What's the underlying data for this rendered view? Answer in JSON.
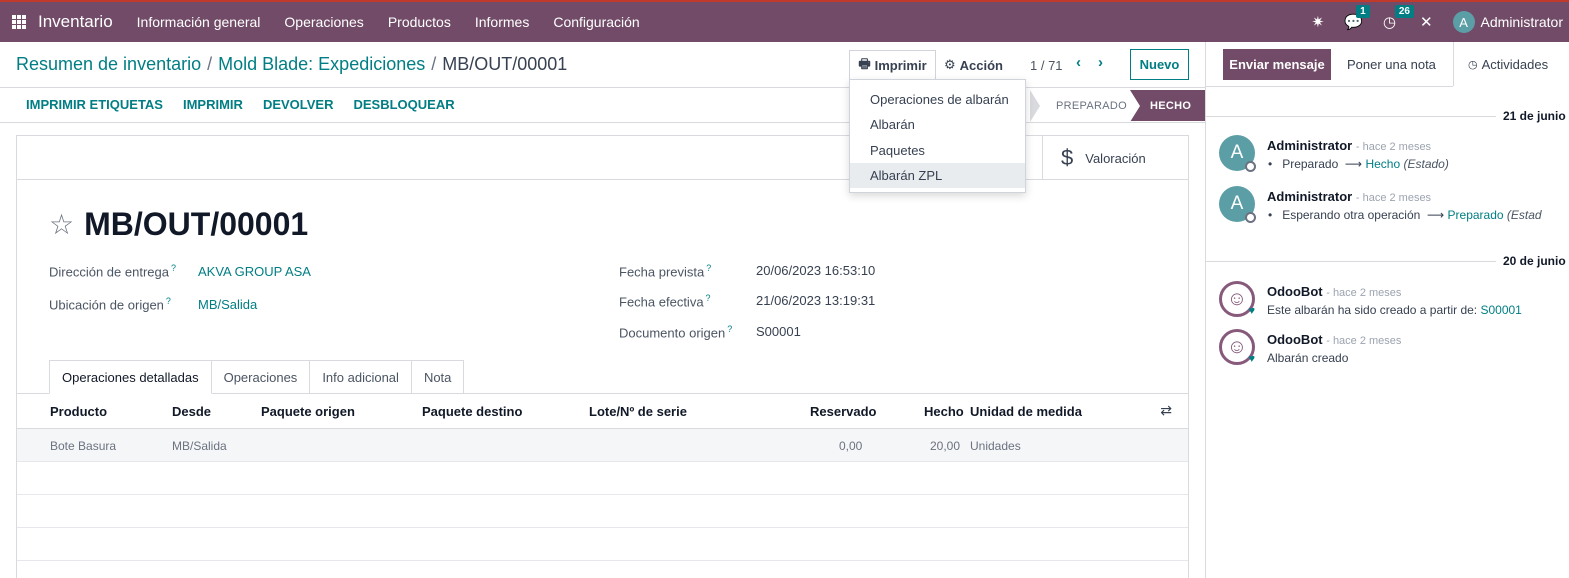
{
  "navbar": {
    "app_name": "Inventario",
    "menu": [
      "Información general",
      "Operaciones",
      "Productos",
      "Informes",
      "Configuración"
    ],
    "messages_badge": "1",
    "activities_badge": "26",
    "user_initial": "A",
    "user_name": "Administrator",
    "icons": [
      "apps-icon",
      "bug-icon",
      "chat-icon",
      "clock-icon",
      "tools-icon"
    ]
  },
  "breadcrumb": {
    "items": [
      "Resumen de inventario",
      "Mold Blade: Expediciones"
    ],
    "current": "MB/OUT/00001",
    "separator": "/"
  },
  "toolbar": {
    "print_label": "Imprimir",
    "action_label": "Acción",
    "pager": "1 / 71",
    "new_label": "Nuevo"
  },
  "print_menu": {
    "items": [
      "Operaciones de albarán",
      "Albarán",
      "Paquetes",
      "Albarán ZPL"
    ],
    "highlighted": "Albarán ZPL"
  },
  "header_buttons": [
    "IMPRIMIR ETIQUETAS",
    "IMPRIMIR",
    "DEVOLVER",
    "DESBLOQUEAR"
  ],
  "statusbar": {
    "stages": [
      "PREPARADO",
      "HECHO"
    ],
    "current": "HECHO"
  },
  "form": {
    "valuation_label": "Valoración",
    "title": "MB/OUT/00001",
    "fields": {
      "delivery_address": {
        "label": "Dirección de entrega",
        "value": "AKVA GROUP ASA"
      },
      "source_location": {
        "label": "Ubicación de origen",
        "value": "MB/Salida"
      },
      "scheduled_date": {
        "label": "Fecha prevista",
        "value": "20/06/2023 16:53:10"
      },
      "effective_date": {
        "label": "Fecha efectiva",
        "value": "21/06/2023 13:19:31"
      },
      "source_document": {
        "label": "Documento origen",
        "value": "S00001"
      }
    },
    "help_mark": "?",
    "tabs": [
      "Operaciones detalladas",
      "Operaciones",
      "Info adicional",
      "Nota"
    ],
    "active_tab": "Operaciones detalladas",
    "table": {
      "columns": [
        "Producto",
        "Desde",
        "Paquete origen",
        "Paquete destino",
        "Lote/Nº de serie",
        "Reservado",
        "Hecho",
        "Unidad de medida"
      ],
      "rows": [
        {
          "product": "Bote Basura",
          "from": "MB/Salida",
          "src_package": "",
          "dest_package": "",
          "lot": "",
          "reserved": "0,00",
          "done": "20,00",
          "uom": "Unidades"
        }
      ]
    }
  },
  "chatter": {
    "send_message": "Enviar mensaje",
    "log_note": "Poner una nota",
    "activities": "Actividades",
    "groups": [
      {
        "date": "21 de junio",
        "messages": [
          {
            "author": "Administrator",
            "time": "- hace 2 meses",
            "from": "Preparado",
            "to": "Hecho",
            "field": "(Estado)"
          },
          {
            "author": "Administrator",
            "time": "- hace 2 meses",
            "from": "Esperando otra operación",
            "to": "Preparado",
            "field": "(Estad"
          }
        ]
      },
      {
        "date": "20 de junio",
        "messages": [
          {
            "author": "OdooBot",
            "time": "- hace 2 meses",
            "text": "Este albarán ha sido creado a partir de:",
            "link": "S00001"
          },
          {
            "author": "OdooBot",
            "time": "- hace 2 meses",
            "text": "Albarán creado"
          }
        ]
      }
    ]
  },
  "colors": {
    "brand": "#714B67",
    "link": "#017E84"
  }
}
